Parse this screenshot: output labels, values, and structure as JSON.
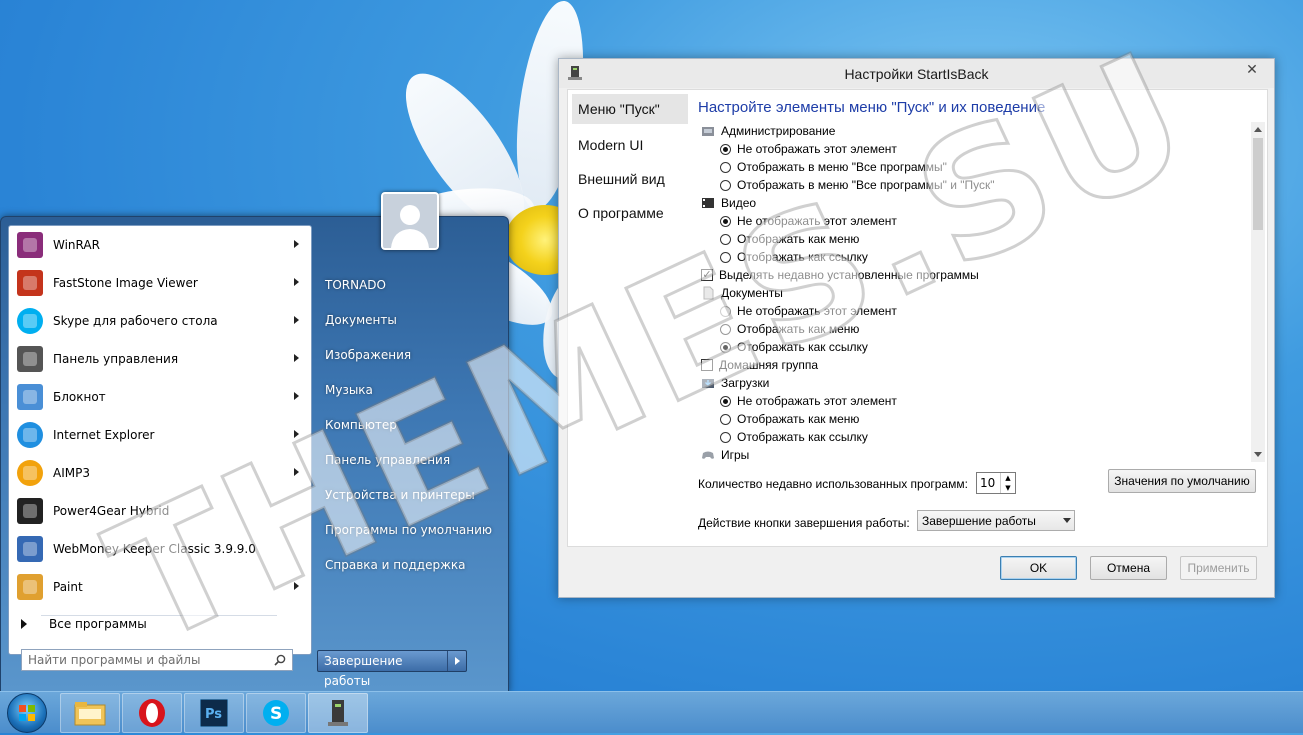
{
  "dialog": {
    "title": "Настройки StartIsBack",
    "close_glyph": "✕",
    "nav": [
      "Меню \"Пуск\"",
      "Modern UI",
      "Внешний вид",
      "О программе"
    ],
    "heading": "Настройте элементы меню \"Пуск\" и их поведение",
    "rows": {
      "admin": "Администрирование",
      "admin_o1": "Не отображать этот элемент",
      "admin_o2": "Отображать в меню \"Все программы\"",
      "admin_o3": "Отображать в меню \"Все программы\" и \"Пуск\"",
      "video": "Видео",
      "video_o1": "Не отображать этот элемент",
      "video_o2": "Отображать как меню",
      "video_o3": "Отображать как ссылку",
      "highlight_new": "Выделять недавно установленные программы",
      "docs": "Документы",
      "docs_o1": "Не отображать этот элемент",
      "docs_o2": "Отображать как меню",
      "docs_o3": "Отображать как ссылку",
      "homegroup": "Домашняя группа",
      "downloads": "Загрузки",
      "dl_o1": "Не отображать этот элемент",
      "dl_o2": "Отображать как меню",
      "dl_o3": "Отображать как ссылку",
      "games": "Игры"
    },
    "recent_label": "Количество недавно использованных программ:",
    "recent_value": "10",
    "defaults_button": "Значения по умолчанию",
    "shutdown_label": "Действие кнопки завершения работы:",
    "shutdown_value": "Завершение работы",
    "ok": "OK",
    "cancel": "Отмена",
    "apply": "Применить"
  },
  "start_menu": {
    "programs": [
      {
        "label": "WinRAR",
        "icon": "winrar-icon",
        "color": "#8a2d7a"
      },
      {
        "label": "FastStone Image Viewer",
        "icon": "faststone-icon",
        "color": "#c4341c"
      },
      {
        "label": "Skype для рабочего стола",
        "icon": "skype-icon",
        "color": "#00aff0"
      },
      {
        "label": "Панель управления",
        "icon": "tools-icon",
        "color": "#555555"
      },
      {
        "label": "Блокнот",
        "icon": "notepad-icon",
        "color": "#4a8fd6"
      },
      {
        "label": "Internet Explorer",
        "icon": "ie-icon",
        "color": "#1f8fe0"
      },
      {
        "label": "AIMP3",
        "icon": "aimp-icon",
        "color": "#f2a20c"
      },
      {
        "label": "Power4Gear Hybrid",
        "icon": "power4gear-icon",
        "color": "#222222"
      },
      {
        "label": "WebMoney Keeper Classic 3.9.9.0",
        "icon": "webmoney-icon",
        "color": "#3569b4"
      },
      {
        "label": "Paint",
        "icon": "paint-icon",
        "color": "#e0a030"
      }
    ],
    "all_programs": "Все программы",
    "search_placeholder": "Найти программы и файлы",
    "right_items": [
      "TORNADO",
      "Документы",
      "Изображения",
      "Музыка",
      "Компьютер",
      "Панель управления",
      "Устройства и принтеры",
      "Программы по умолчанию",
      "Справка и поддержка"
    ],
    "shutdown": "Завершение работы"
  },
  "watermark": "THEMES.SU",
  "colors": {
    "accent": "#1e3da8",
    "desktop": "#2a84d6"
  }
}
